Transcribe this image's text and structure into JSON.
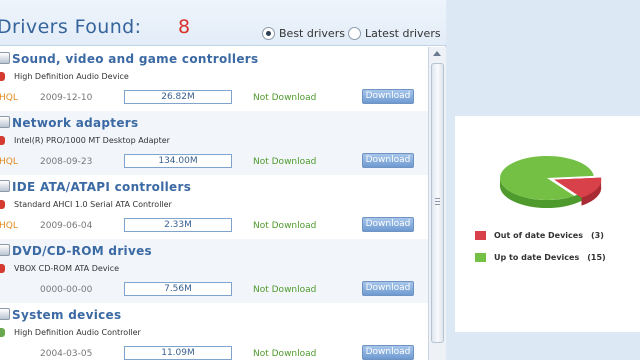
{
  "header": {
    "title": "Drivers Found:",
    "count": "8",
    "radio_best": "Best drivers",
    "radio_latest": "Latest drivers"
  },
  "drivers": [
    {
      "category": "Sound, video and game controllers",
      "device": "High Definition Audio Device",
      "quality": "HQL",
      "date": "2009-12-10",
      "size": "26.82M",
      "status": "Not Download",
      "button": "Download"
    },
    {
      "category": "Network adapters",
      "device": "Intel(R) PRO/1000 MT Desktop Adapter",
      "quality": "HQL",
      "date": "2008-09-23",
      "size": "134.00M",
      "status": "Not Download",
      "button": "Download"
    },
    {
      "category": "IDE ATA/ATAPI controllers",
      "device": "Standard AHCI 1.0 Serial ATA Controller",
      "quality": "HQL",
      "date": "2009-06-04",
      "size": "2.33M",
      "status": "Not Download",
      "button": "Download"
    },
    {
      "category": "DVD/CD-ROM drives",
      "device": "VBOX CD-ROM ATA Device",
      "quality": "",
      "date": "0000-00-00",
      "size": "7.56M",
      "status": "Not Download",
      "button": "Download"
    },
    {
      "category": "System devices",
      "device": "High Definition Audio Controller",
      "quality": "",
      "date": "2004-03-05",
      "size": "11.09M",
      "status": "Not Download",
      "button": "Download"
    }
  ],
  "pie": {
    "out_of_date_label": "Out of date Devices",
    "out_of_date_count": "(3)",
    "up_to_date_label": "Up to date Devices",
    "up_to_date_count": "(15)",
    "out_of_date_value": 3,
    "up_to_date_value": 15,
    "colors": {
      "out_of_date": "#d9414a",
      "up_to_date": "#74c044"
    }
  },
  "colors": {
    "accent": "#35649c",
    "count": "#d9302a",
    "status": "#4e9a2c",
    "quality": "#e08a1e"
  }
}
